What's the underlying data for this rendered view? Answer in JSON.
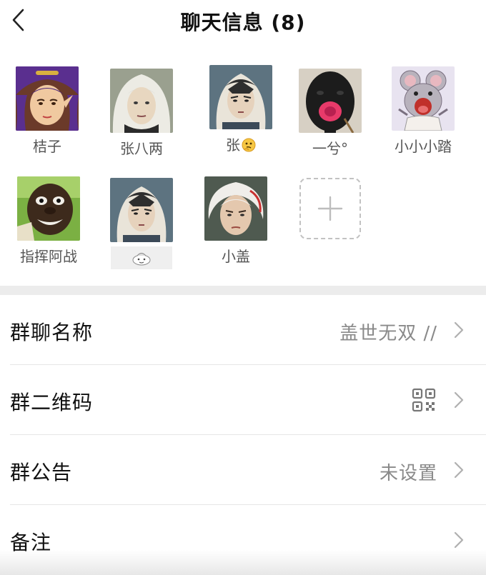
{
  "header": {
    "title": "聊天信息 (8)",
    "back_icon": "back-chevron-icon"
  },
  "members": [
    {
      "name": "桔子",
      "avatar": "purple-haired-character-avatar"
    },
    {
      "name": "张八两",
      "avatar": "white-hooded-character-avatar"
    },
    {
      "name": "张",
      "emoji": "thinking-face-emoji",
      "avatar": "swordsman-character-avatar"
    },
    {
      "name": "一兮°",
      "avatar": "dark-face-red-mouth-avatar"
    },
    {
      "name": "小小小踏",
      "avatar": "screaming-mouse-avatar"
    },
    {
      "name": "指挥阿战",
      "avatar": "green-laughing-face-avatar"
    },
    {
      "name": "",
      "name_icon": "small-cartoon-icon",
      "avatar": "swordsman-character-avatar"
    },
    {
      "name": "小盖",
      "avatar": "white-haired-character-avatar"
    }
  ],
  "add_member": {
    "icon": "plus-icon"
  },
  "settings": {
    "group_name": {
      "label": "群聊名称",
      "value": "盖世无双 //"
    },
    "group_qr": {
      "label": "群二维码",
      "icon": "qr-code-icon"
    },
    "announcement": {
      "label": "群公告",
      "value": "未设置"
    },
    "remark": {
      "label": "备注",
      "value": ""
    }
  },
  "colors": {
    "separator": "#ececec",
    "secondary_text": "#8a8a8a"
  }
}
